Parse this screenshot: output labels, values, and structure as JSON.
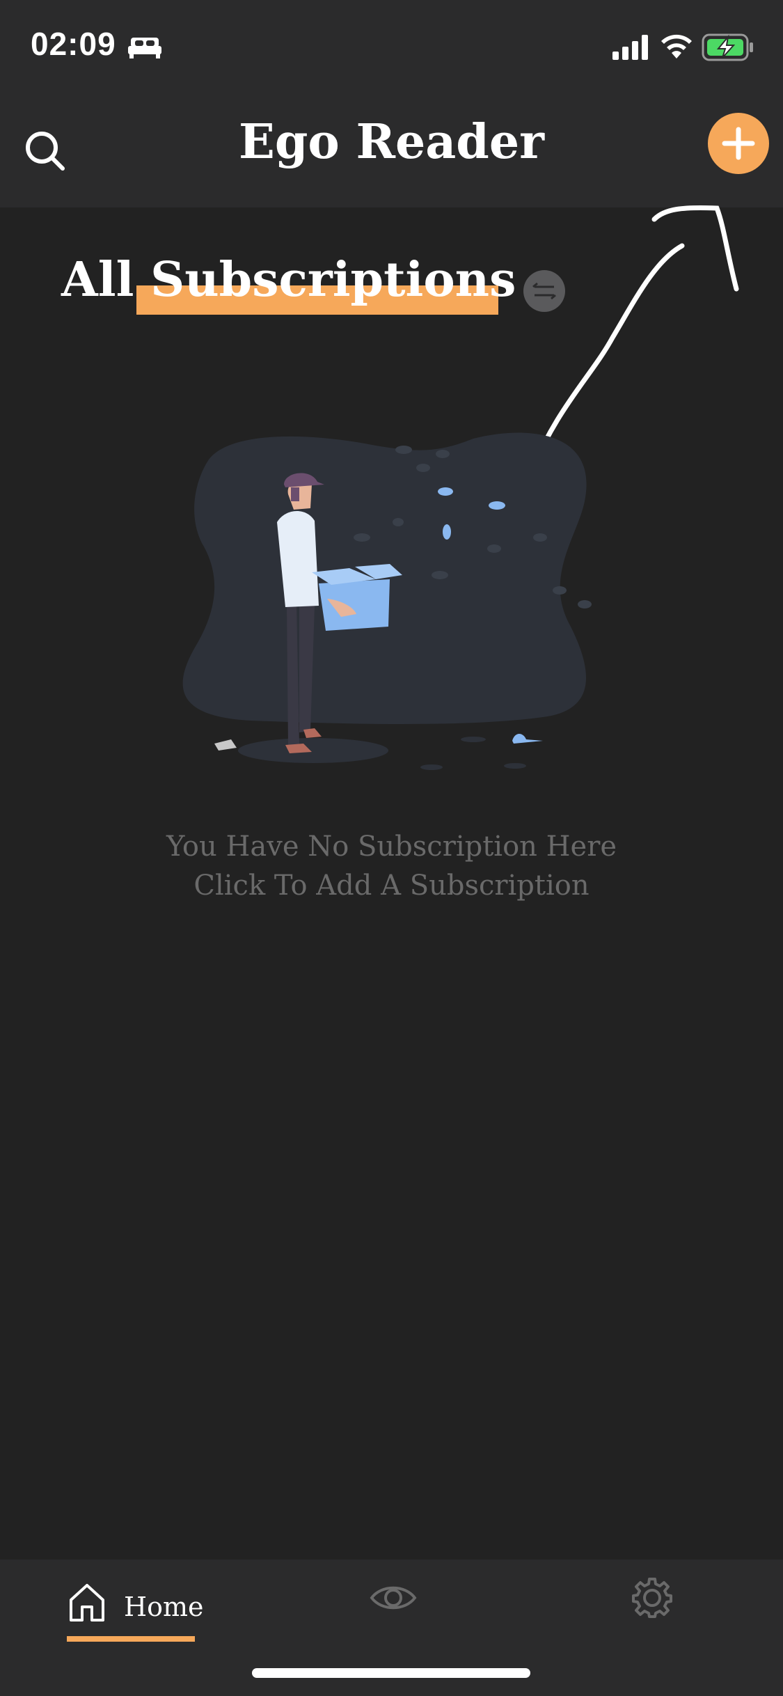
{
  "status_bar": {
    "time": "02:09",
    "icons": [
      "bed-icon",
      "signal-icon",
      "wifi-icon",
      "battery-charging-icon"
    ]
  },
  "header": {
    "title": "Ego Reader",
    "search_icon": "search-icon",
    "add_icon": "plus-icon"
  },
  "section": {
    "title": "All Subscriptions",
    "sort_icon": "swap-arrows-icon"
  },
  "empty_state": {
    "line1": "You Have No Subscription Here",
    "line2": "Click To Add A Subscription"
  },
  "tab_bar": {
    "items": [
      {
        "label": "Home",
        "icon": "home-icon",
        "active": true
      },
      {
        "label": "",
        "icon": "eye-icon",
        "active": false
      },
      {
        "label": "",
        "icon": "gear-icon",
        "active": false
      }
    ]
  },
  "colors": {
    "accent": "#f6a85a",
    "background": "#222222",
    "bar": "#2b2b2c",
    "muted_text": "#6a6a6a"
  }
}
